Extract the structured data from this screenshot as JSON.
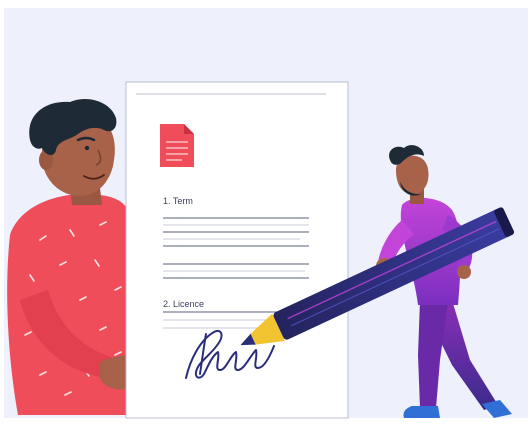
{
  "document": {
    "section_1": "1. Term",
    "section_2": "2. Licence"
  },
  "colors": {
    "background": "#eef0fb",
    "paper": "#ffffff",
    "file_icon": "#ef4d5a",
    "shirt_left": "#ef4d5a",
    "shirt_right": "#b23fd6",
    "pencil_body": "#2b2a6b",
    "pencil_ferrule": "#f3c431",
    "signature_ink": "#2a2d7a"
  },
  "icons": [
    "file-icon",
    "pencil-icon",
    "signature-mark"
  ]
}
